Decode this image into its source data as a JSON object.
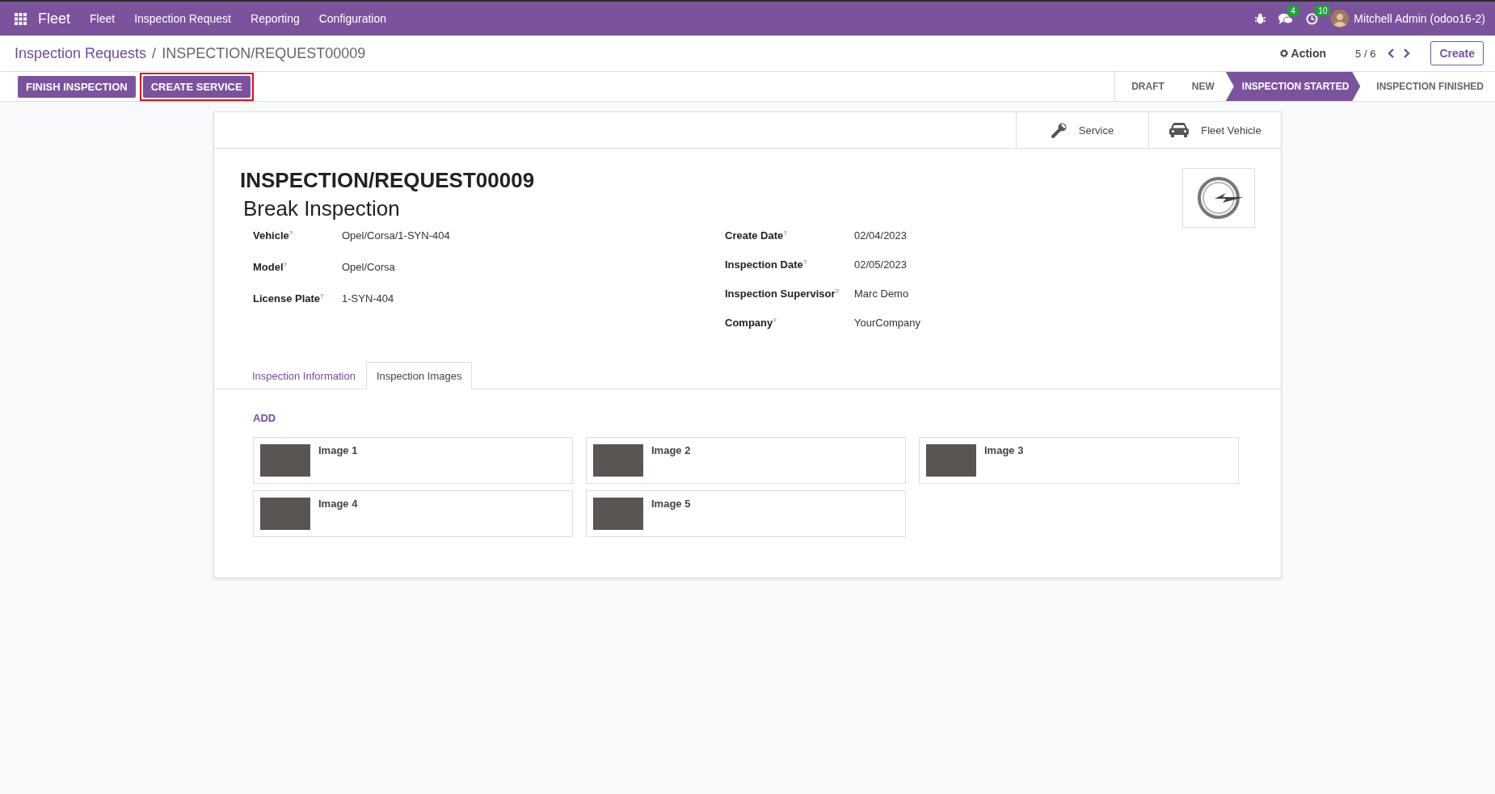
{
  "navbar": {
    "app_name": "Fleet",
    "menus": [
      "Fleet",
      "Inspection Request",
      "Reporting",
      "Configuration"
    ],
    "messages_count": "4",
    "activities_count": "10",
    "user": "Mitchell Admin (odoo16-2)"
  },
  "breadcrumb": {
    "parent": "Inspection Requests",
    "separator": "/",
    "current": "INSPECTION/REQUEST00009"
  },
  "control_panel": {
    "action": "Action",
    "pager": "5 / 6",
    "create": "Create"
  },
  "header_buttons": [
    {
      "label": "FINISH INSPECTION",
      "highlighted": false
    },
    {
      "label": "CREATE SERVICE",
      "highlighted": true
    }
  ],
  "stages": [
    {
      "label": "DRAFT",
      "selected": false
    },
    {
      "label": "NEW",
      "selected": false
    },
    {
      "label": "INSPECTION STARTED",
      "selected": true
    },
    {
      "label": "INSPECTION FINISHED",
      "selected": false
    }
  ],
  "smart_buttons": [
    {
      "kind": "wrench",
      "label": "Service"
    },
    {
      "kind": "car",
      "label": "Fleet Vehicle"
    }
  ],
  "record": {
    "reference": "INSPECTION/REQUEST00009",
    "name": "Break Inspection"
  },
  "fields_left": [
    {
      "label": "Vehicle$^{?}$",
      "value": "Opel/Corsa/1-SYN-404"
    },
    {
      "label": "Model$^{?}$",
      "value": "Opel/Corsa"
    },
    {
      "label": "License Plate$^{?}$",
      "value": "1-SYN-404"
    }
  ],
  "fields_right": [
    {
      "label": "Create Date$^{?}$",
      "value": "02/04/2023"
    },
    {
      "label": "Inspection Date$^{?}$",
      "value": "02/05/2023"
    },
    {
      "label": "Inspection Supervisor$^{?}$",
      "value": "Marc Demo"
    },
    {
      "label": "Company$^{?}$",
      "value": "YourCompany"
    }
  ],
  "tabs": [
    {
      "label": "Inspection Information",
      "selected": false
    },
    {
      "label": "Inspection Images",
      "selected": true
    }
  ],
  "add_link": "ADD",
  "images": [
    {
      "name": "Image 1"
    },
    {
      "name": "Image 2"
    },
    {
      "name": "Image 3"
    },
    {
      "name": "Image 4"
    },
    {
      "name": "Image 5"
    }
  ]
}
